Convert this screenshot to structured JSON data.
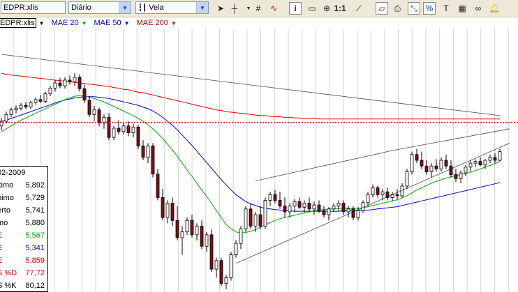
{
  "toolbar": {
    "symbol": "EDPR:xlis",
    "period": "Diário",
    "chart_type": "Vela",
    "zoom_label": "1:1",
    "icons": [
      "cursor-icon",
      "crosshair-icon",
      "grid-icon",
      "indicator-icon",
      "info-icon",
      "zoom-in-icon",
      "zoom-out-icon",
      "scale-icon",
      "line-tool-icon",
      "eraser-icon",
      "print-icon",
      "fit-icon",
      "compare-icon",
      "text-icon",
      "link-icon",
      "alert-icon"
    ]
  },
  "legend": {
    "symbol": "EDPR:xlis",
    "ma20": "MAE 20",
    "ma50": "MAE 50",
    "ma200": "MAE 200",
    "colors": {
      "ma20": "#00aa00",
      "ma50": "#0000dd",
      "ma200": "#dd0000",
      "symbol": "#000000"
    }
  },
  "databox": {
    "date": "02-2009",
    "rows": [
      {
        "label": "ximo",
        "value": "5,892",
        "color": "#000000"
      },
      {
        "label": "nimo",
        "value": "5,729",
        "color": "#000000"
      },
      {
        "label": "erto",
        "value": "5,741",
        "color": "#000000"
      },
      {
        "label": "mo",
        "value": "5,880",
        "color": "#000000"
      },
      {
        "label": "E",
        "value": "5,567",
        "color": "#00aa00"
      },
      {
        "label": "E",
        "value": "5,341",
        "color": "#0000dd"
      },
      {
        "label": "E",
        "value": "5,859",
        "color": "#dd0000"
      },
      {
        "label": "S %D",
        "value": "77,72",
        "color": "#dd0000"
      },
      {
        "label": "S %K",
        "value": "80,12",
        "color": "#000000"
      }
    ]
  },
  "chart_data": {
    "type": "candlestick",
    "series_name": "EDPR:xlis",
    "candles": [
      [
        5.7,
        5.84,
        5.62,
        5.78
      ],
      [
        5.78,
        5.95,
        5.74,
        5.9
      ],
      [
        5.9,
        6.02,
        5.85,
        5.98
      ],
      [
        5.98,
        6.06,
        5.92,
        6.01
      ],
      [
        6.01,
        6.1,
        5.97,
        6.06
      ],
      [
        6.06,
        6.12,
        5.99,
        6.03
      ],
      [
        6.03,
        6.14,
        6.0,
        6.11
      ],
      [
        6.11,
        6.2,
        6.07,
        6.16
      ],
      [
        6.16,
        6.24,
        6.1,
        6.13
      ],
      [
        6.13,
        6.3,
        6.1,
        6.26
      ],
      [
        6.26,
        6.4,
        6.22,
        6.36
      ],
      [
        6.36,
        6.5,
        6.3,
        6.45
      ],
      [
        6.45,
        6.54,
        6.36,
        6.4
      ],
      [
        6.4,
        6.55,
        6.35,
        6.5
      ],
      [
        6.5,
        6.58,
        6.42,
        6.47
      ],
      [
        6.47,
        6.62,
        6.4,
        6.55
      ],
      [
        6.55,
        6.6,
        6.3,
        6.35
      ],
      [
        6.35,
        6.42,
        6.1,
        6.15
      ],
      [
        6.15,
        6.22,
        5.85,
        5.9
      ],
      [
        5.9,
        6.05,
        5.78,
        5.98
      ],
      [
        5.98,
        6.02,
        5.7,
        5.75
      ],
      [
        5.75,
        5.9,
        5.65,
        5.85
      ],
      [
        5.85,
        5.92,
        5.45,
        5.5
      ],
      [
        5.5,
        5.7,
        5.45,
        5.66
      ],
      [
        5.66,
        5.8,
        5.55,
        5.6
      ],
      [
        5.6,
        5.75,
        5.55,
        5.7
      ],
      [
        5.7,
        5.78,
        5.52,
        5.58
      ],
      [
        5.58,
        5.74,
        5.5,
        5.68
      ],
      [
        5.68,
        5.72,
        5.3,
        5.35
      ],
      [
        5.35,
        5.45,
        5.1,
        5.15
      ],
      [
        5.15,
        5.4,
        5.05,
        5.35
      ],
      [
        5.35,
        5.4,
        4.8,
        4.86
      ],
      [
        4.86,
        4.95,
        4.4,
        4.45
      ],
      [
        4.45,
        4.6,
        4.05,
        4.1
      ],
      [
        4.1,
        4.4,
        4.0,
        4.35
      ],
      [
        4.35,
        4.45,
        3.95,
        4.05
      ],
      [
        4.05,
        4.3,
        3.7,
        3.75
      ],
      [
        3.75,
        3.95,
        3.45,
        3.85
      ],
      [
        3.85,
        4.1,
        3.8,
        4.05
      ],
      [
        4.05,
        4.15,
        3.75,
        3.8
      ],
      [
        3.8,
        4.0,
        3.7,
        3.95
      ],
      [
        3.95,
        4.05,
        3.55,
        3.6
      ],
      [
        3.6,
        3.85,
        3.5,
        3.8
      ],
      [
        3.8,
        3.9,
        3.15,
        3.2
      ],
      [
        3.2,
        3.4,
        3.05,
        3.35
      ],
      [
        3.35,
        3.4,
        2.9,
        2.95
      ],
      [
        2.95,
        3.1,
        2.85,
        3.05
      ],
      [
        3.05,
        3.5,
        3.0,
        3.45
      ],
      [
        3.45,
        3.7,
        3.4,
        3.65
      ],
      [
        3.65,
        3.95,
        3.55,
        3.9
      ],
      [
        3.9,
        4.3,
        3.85,
        4.25
      ],
      [
        4.25,
        4.35,
        3.9,
        3.95
      ],
      [
        3.95,
        4.2,
        3.85,
        4.15
      ],
      [
        4.15,
        4.3,
        3.9,
        3.95
      ],
      [
        3.95,
        4.45,
        3.9,
        4.4
      ],
      [
        4.4,
        4.55,
        4.3,
        4.5
      ],
      [
        4.5,
        4.58,
        4.35,
        4.4
      ],
      [
        4.4,
        4.55,
        4.25,
        4.3
      ],
      [
        4.3,
        4.45,
        4.1,
        4.2
      ],
      [
        4.2,
        4.35,
        4.1,
        4.3
      ],
      [
        4.3,
        4.42,
        4.2,
        4.38
      ],
      [
        4.38,
        4.45,
        4.25,
        4.28
      ],
      [
        4.28,
        4.4,
        4.18,
        4.35
      ],
      [
        4.35,
        4.45,
        4.2,
        4.25
      ],
      [
        4.25,
        4.38,
        4.15,
        4.32
      ],
      [
        4.32,
        4.4,
        4.18,
        4.22
      ],
      [
        4.22,
        4.3,
        4.1,
        4.15
      ],
      [
        4.15,
        4.28,
        4.05,
        4.25
      ],
      [
        4.25,
        4.35,
        4.2,
        4.3
      ],
      [
        4.3,
        4.4,
        4.22,
        4.35
      ],
      [
        4.35,
        4.4,
        4.15,
        4.2
      ],
      [
        4.2,
        4.3,
        4.1,
        4.25
      ],
      [
        4.25,
        4.3,
        4.05,
        4.1
      ],
      [
        4.1,
        4.28,
        4.05,
        4.22
      ],
      [
        4.22,
        4.4,
        4.18,
        4.36
      ],
      [
        4.36,
        4.55,
        4.3,
        4.5
      ],
      [
        4.5,
        4.68,
        4.45,
        4.62
      ],
      [
        4.62,
        4.65,
        4.45,
        4.5
      ],
      [
        4.5,
        4.6,
        4.4,
        4.55
      ],
      [
        4.55,
        4.62,
        4.4,
        4.45
      ],
      [
        4.45,
        4.55,
        4.38,
        4.5
      ],
      [
        4.5,
        4.6,
        4.42,
        4.48
      ],
      [
        4.48,
        4.7,
        4.45,
        4.65
      ],
      [
        4.65,
        4.95,
        4.6,
        4.9
      ],
      [
        4.9,
        5.25,
        4.85,
        5.2
      ],
      [
        5.2,
        5.3,
        5.05,
        5.1
      ],
      [
        5.1,
        5.25,
        4.95,
        5.0
      ],
      [
        5.0,
        5.1,
        4.85,
        4.9
      ],
      [
        4.9,
        5.05,
        4.8,
        5.0
      ],
      [
        5.0,
        5.12,
        4.9,
        4.95
      ],
      [
        4.95,
        5.15,
        4.9,
        5.1
      ],
      [
        5.1,
        5.2,
        4.95,
        5.0
      ],
      [
        5.0,
        5.1,
        4.8,
        4.85
      ],
      [
        4.85,
        4.95,
        4.72,
        4.78
      ],
      [
        4.78,
        4.92,
        4.7,
        4.88
      ],
      [
        4.88,
        5.02,
        4.82,
        4.98
      ],
      [
        4.98,
        5.1,
        4.9,
        5.05
      ],
      [
        5.05,
        5.12,
        4.98,
        5.08
      ],
      [
        5.08,
        5.15,
        5.0,
        5.02
      ],
      [
        5.02,
        5.12,
        4.95,
        5.1
      ],
      [
        5.1,
        5.2,
        5.05,
        5.15
      ],
      [
        5.15,
        5.22,
        5.05,
        5.1
      ],
      [
        5.1,
        5.3,
        5.08,
        5.25
      ]
    ],
    "ma20": [
      5.6,
      5.65,
      5.7,
      5.75,
      5.8,
      5.84,
      5.88,
      5.92,
      5.96,
      6.0,
      6.04,
      6.08,
      6.12,
      6.16,
      6.19,
      6.22,
      6.23,
      6.22,
      6.2,
      6.18,
      6.15,
      6.12,
      6.08,
      6.04,
      6.0,
      5.96,
      5.92,
      5.88,
      5.83,
      5.78,
      5.72,
      5.65,
      5.57,
      5.48,
      5.38,
      5.28,
      5.17,
      5.05,
      4.93,
      4.82,
      4.7,
      4.58,
      4.47,
      4.35,
      4.22,
      4.1,
      3.98,
      3.9,
      3.85,
      3.83,
      3.84,
      3.86,
      3.89,
      3.93,
      3.97,
      4.01,
      4.05,
      4.08,
      4.1,
      4.12,
      4.14,
      4.16,
      4.18,
      4.2,
      4.22,
      4.23,
      4.24,
      4.25,
      4.25,
      4.26,
      4.26,
      4.26,
      4.26,
      4.26,
      4.27,
      4.29,
      4.31,
      4.33,
      4.35,
      4.37,
      4.39,
      4.41,
      4.44,
      4.48,
      4.53,
      4.58,
      4.62,
      4.66,
      4.7,
      4.73,
      4.76,
      4.79,
      4.81,
      4.83,
      4.85,
      4.87,
      4.89,
      4.92,
      4.95,
      4.98,
      5.01,
      5.04,
      5.08
    ],
    "ma50": [
      5.78,
      5.8,
      5.83,
      5.86,
      5.89,
      5.92,
      5.95,
      5.98,
      6.01,
      6.04,
      6.07,
      6.1,
      6.13,
      6.15,
      6.17,
      6.19,
      6.2,
      6.21,
      6.21,
      6.21,
      6.2,
      6.19,
      6.18,
      6.16,
      6.14,
      6.12,
      6.1,
      6.08,
      6.06,
      6.03,
      6.0,
      5.96,
      5.91,
      5.85,
      5.78,
      5.71,
      5.63,
      5.54,
      5.45,
      5.36,
      5.26,
      5.16,
      5.06,
      4.96,
      4.86,
      4.76,
      4.67,
      4.58,
      4.5,
      4.44,
      4.38,
      4.34,
      4.31,
      4.28,
      4.26,
      4.25,
      4.24,
      4.23,
      4.22,
      4.22,
      4.21,
      4.21,
      4.21,
      4.21,
      4.21,
      4.21,
      4.21,
      4.21,
      4.21,
      4.21,
      4.22,
      4.22,
      4.22,
      4.22,
      4.23,
      4.23,
      4.24,
      4.25,
      4.26,
      4.27,
      4.28,
      4.29,
      4.31,
      4.33,
      4.35,
      4.37,
      4.39,
      4.41,
      4.43,
      4.45,
      4.47,
      4.49,
      4.51,
      4.53,
      4.55,
      4.57,
      4.59,
      4.61,
      4.63,
      4.65,
      4.67,
      4.69,
      4.71
    ],
    "ma200": [
      6.62,
      6.6,
      6.59,
      6.58,
      6.57,
      6.56,
      6.55,
      6.54,
      6.53,
      6.52,
      6.51,
      6.5,
      6.49,
      6.48,
      6.47,
      6.46,
      6.45,
      6.44,
      6.43,
      6.42,
      6.41,
      6.4,
      6.39,
      6.37,
      6.36,
      6.34,
      6.33,
      6.31,
      6.29,
      6.28,
      6.26,
      6.24,
      6.22,
      6.2,
      6.18,
      6.16,
      6.14,
      6.12,
      6.1,
      6.08,
      6.06,
      6.04,
      6.02,
      6.0,
      5.98,
      5.97,
      5.95,
      5.94,
      5.93,
      5.92,
      5.91,
      5.9,
      5.89,
      5.88,
      5.88,
      5.87,
      5.86,
      5.86,
      5.85,
      5.85,
      5.84,
      5.84,
      5.83,
      5.83,
      5.83,
      5.82,
      5.82,
      5.82,
      5.82,
      5.82,
      5.82,
      5.82,
      5.82,
      5.82,
      5.82,
      5.82,
      5.82,
      5.82,
      5.82,
      5.82,
      5.82,
      5.82,
      5.82,
      5.82,
      5.82,
      5.82,
      5.82,
      5.82,
      5.82,
      5.82,
      5.82,
      5.82,
      5.82,
      5.82,
      5.82,
      5.82,
      5.82,
      5.82,
      5.82,
      5.82,
      5.82,
      5.82,
      5.82
    ],
    "resistance_level": 5.76,
    "trendlines": [
      {
        "start": [
          0,
          6.95
        ],
        "end": [
          102,
          5.88
        ],
        "color": "#000000"
      },
      {
        "start": [
          52,
          4.74
        ],
        "end": [
          80,
          5.27
        ],
        "color": "#000000"
      },
      {
        "start": [
          80,
          5.27
        ],
        "end": [
          104,
          5.65
        ],
        "color": "#000000"
      },
      {
        "start": [
          48,
          3.3
        ],
        "end": [
          104,
          5.4
        ],
        "color": "#000000"
      }
    ],
    "ylim": [
      2.8,
      7.4
    ],
    "grid": true
  }
}
